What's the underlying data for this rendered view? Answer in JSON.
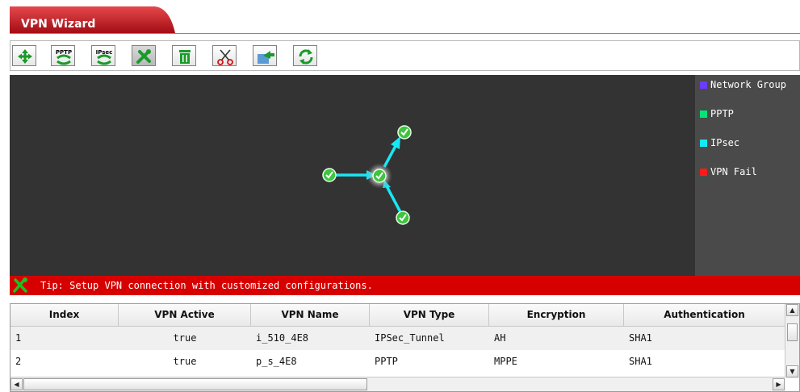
{
  "window": {
    "title": "VPN Wizard"
  },
  "toolbar": {
    "buttons": [
      {
        "name": "add-button",
        "icon": "move-cross-icon"
      },
      {
        "name": "pptp-button",
        "icon": "pptp-icon",
        "label": "PPTP"
      },
      {
        "name": "ipsec-button",
        "icon": "ipsec-icon",
        "label": "IPsec"
      },
      {
        "name": "custom-config-button",
        "icon": "tools-icon"
      },
      {
        "name": "delete-button",
        "icon": "trash-icon"
      },
      {
        "name": "cut-button",
        "icon": "scissors-icon"
      },
      {
        "name": "export-button",
        "icon": "export-icon"
      },
      {
        "name": "refresh-button",
        "icon": "refresh-icon"
      }
    ]
  },
  "legend": {
    "items": [
      {
        "label": "Network Group",
        "color": "#6a3cff"
      },
      {
        "label": "PPTP",
        "color": "#00e676"
      },
      {
        "label": "IPsec",
        "color": "#17e8f5"
      },
      {
        "label": "VPN Fail",
        "color": "#ff1a1a"
      }
    ]
  },
  "tip": {
    "text": "Tip: Setup VPN connection with customized configurations."
  },
  "table": {
    "columns": [
      "Index",
      "VPN Active",
      "VPN Name",
      "VPN Type",
      "Encryption",
      "Authentication"
    ],
    "rows": [
      [
        "1",
        "true",
        "i_510_4E8",
        "IPSec_Tunnel",
        "AH",
        "SHA1"
      ],
      [
        "2",
        "true",
        "p_s_4E8",
        "PPTP",
        "MPPE",
        "SHA1"
      ]
    ]
  },
  "colors": {
    "accent": "#d60000",
    "canvas": "#333333",
    "link": "#17e8f5",
    "node_ok": "#3fc43f"
  }
}
